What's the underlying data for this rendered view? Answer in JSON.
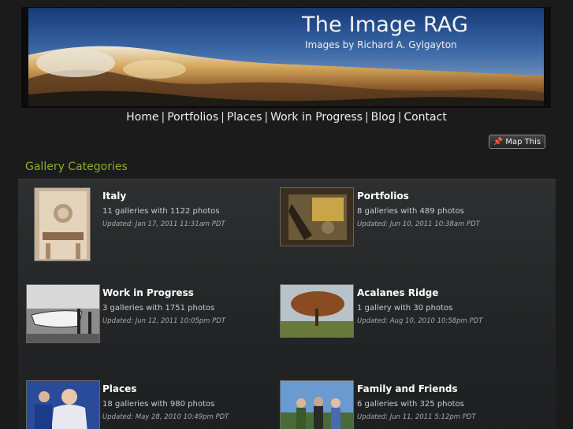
{
  "header": {
    "title": "The Image RAG",
    "subtitle": "Images by Richard A. Gylgayton"
  },
  "nav": {
    "items": [
      "Home",
      "Portfolios",
      "Places",
      "Work in Progress",
      "Blog",
      "Contact"
    ],
    "separator": "|"
  },
  "map_button": {
    "label": "Map This",
    "icon": "pin-icon"
  },
  "section_title": "Gallery Categories",
  "galleries": [
    {
      "title": "Italy",
      "count": "11 galleries with 1122 photos",
      "updated": "Updated: Jan 17, 2011 11:31am PDT"
    },
    {
      "title": "Portfolios",
      "count": "8 galleries with 489 photos",
      "updated": "Updated: Jun 10, 2011 10:38am PDT"
    },
    {
      "title": "Work in Progress",
      "count": "3 galleries with 1751 photos",
      "updated": "Updated: Jun 12, 2011 10:05pm PDT"
    },
    {
      "title": "Acalanes Ridge",
      "count": "1 gallery with 30 photos",
      "updated": "Updated: Aug 10, 2010 10:58pm PDT"
    },
    {
      "title": "Places",
      "count": "18 galleries with 980 photos",
      "updated": "Updated: May 28, 2010 10:49pm PDT"
    },
    {
      "title": "Family and Friends",
      "count": "6 galleries with 325 photos",
      "updated": "Updated: Jun 11, 2011 5:12pm PDT"
    }
  ],
  "colors": {
    "background": "#1b1b1b",
    "accent_green": "#8bb02d",
    "panel": "#2d2f30"
  }
}
